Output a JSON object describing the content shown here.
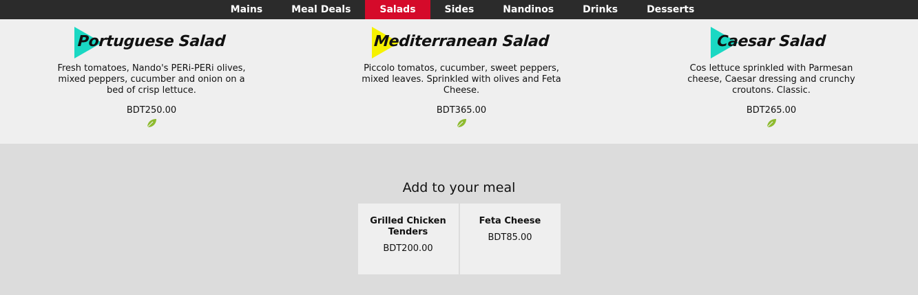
{
  "nav": {
    "items": [
      {
        "label": "Mains"
      },
      {
        "label": "Meal Deals"
      },
      {
        "label": "Salads",
        "active": true
      },
      {
        "label": "Sides"
      },
      {
        "label": "Nandinos"
      },
      {
        "label": "Drinks"
      },
      {
        "label": "Desserts"
      }
    ],
    "active_color": "#d50a2a"
  },
  "products": [
    {
      "title": "Portuguese Salad",
      "description": "Fresh tomatoes, Nando's PERi-PERi olives, mixed peppers, cucumber and onion on a bed of crisp lettuce.",
      "price": "BDT250.00",
      "triangle_color": "#1ad8c3",
      "icon": "leaf-icon"
    },
    {
      "title": "Mediterranean Salad",
      "description": "Piccolo tomatos, cucumber, sweet peppers, mixed leaves. Sprinkled with olives and Feta Cheese.",
      "price": "BDT365.00",
      "triangle_color": "#f6f200",
      "icon": "leaf-icon"
    },
    {
      "title": "Caesar Salad",
      "description": "Cos lettuce sprinkled with Parmesan cheese, Caesar dressing and crunchy croutons. Classic.",
      "price": "BDT265.00",
      "triangle_color": "#1ad8c3",
      "icon": "leaf-icon"
    }
  ],
  "addons": {
    "title": "Add to your meal",
    "items": [
      {
        "name": "Grilled Chicken Tenders",
        "price": "BDT200.00"
      },
      {
        "name": "Feta Cheese",
        "price": "BDT85.00"
      }
    ]
  }
}
